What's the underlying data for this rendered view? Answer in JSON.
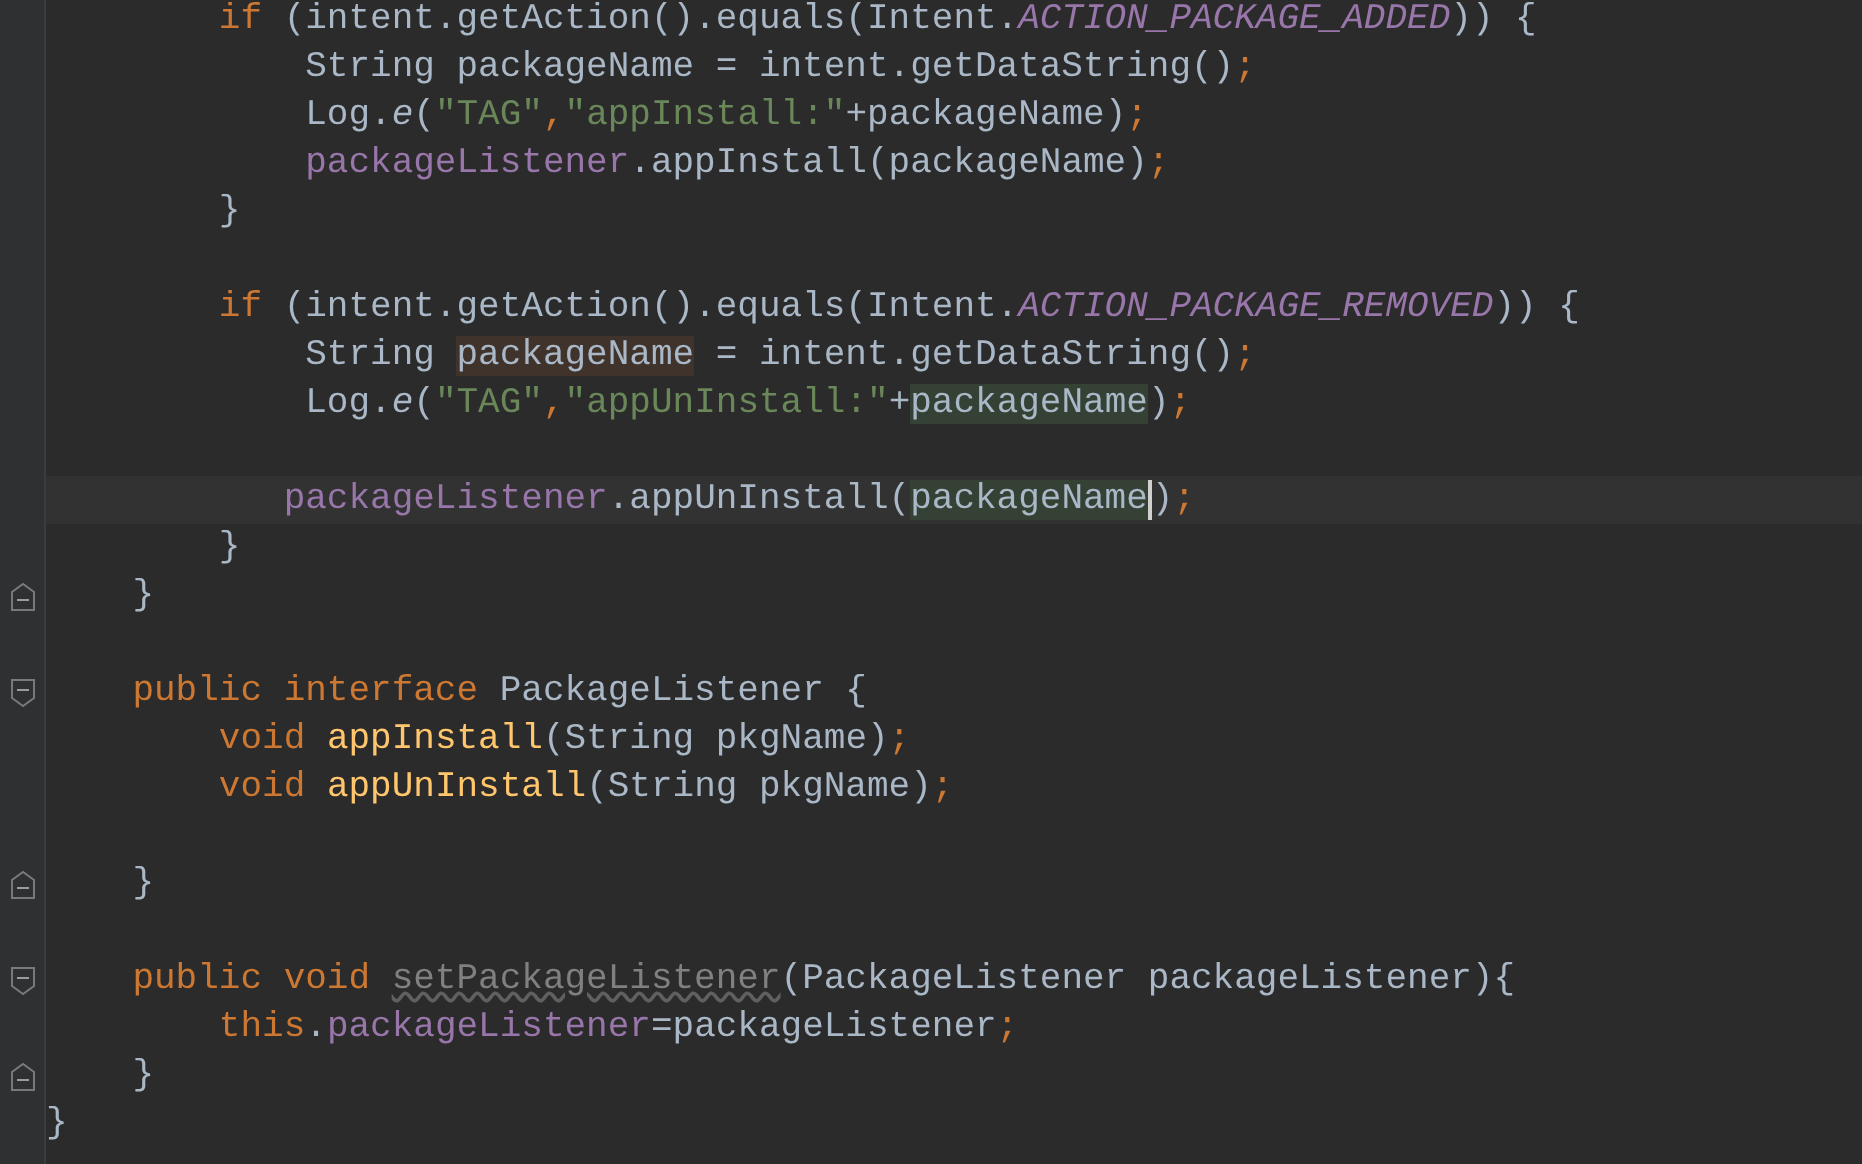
{
  "editor": {
    "lines": [
      {
        "kind": "code",
        "tokens": [
          {
            "text": "        if",
            "kind": "keyword"
          },
          {
            "text": " (intent.getAction().equals(Intent.",
            "kind": "plain"
          },
          {
            "text": "ACTION_PACKAGE_ADDED",
            "kind": "constant"
          },
          {
            "text": ")) {",
            "kind": "plain"
          }
        ]
      },
      {
        "kind": "code",
        "tokens": [
          {
            "text": "            String packageName = intent.getDataString()",
            "kind": "plain"
          },
          {
            "text": ";",
            "kind": "keyword"
          }
        ]
      },
      {
        "kind": "code",
        "tokens": [
          {
            "text": "            Log.",
            "kind": "plain"
          },
          {
            "text": "e",
            "kind": "static"
          },
          {
            "text": "(",
            "kind": "plain"
          },
          {
            "text": "\"TAG\"",
            "kind": "string"
          },
          {
            "text": ",",
            "kind": "keyword"
          },
          {
            "text": "\"appInstall:\"",
            "kind": "string"
          },
          {
            "text": "+packageName)",
            "kind": "plain"
          },
          {
            "text": ";",
            "kind": "keyword"
          }
        ]
      },
      {
        "kind": "code",
        "tokens": [
          {
            "text": "            packageListener",
            "kind": "field"
          },
          {
            "text": ".appInstall(packageName)",
            "kind": "plain"
          },
          {
            "text": ";",
            "kind": "keyword"
          }
        ]
      },
      {
        "kind": "code",
        "tokens": [
          {
            "text": "        }",
            "kind": "plain"
          }
        ]
      },
      {
        "kind": "blank"
      },
      {
        "kind": "code",
        "tokens": [
          {
            "text": "        if",
            "kind": "keyword"
          },
          {
            "text": " (intent.getAction().equals(Intent.",
            "kind": "plain"
          },
          {
            "text": "ACTION_PACKAGE_REMOVED",
            "kind": "constant"
          },
          {
            "text": ")) {",
            "kind": "plain"
          }
        ]
      },
      {
        "kind": "code",
        "tokens": [
          {
            "text": "            String ",
            "kind": "plain"
          },
          {
            "text": "packageName",
            "kind": "write-usage"
          },
          {
            "text": " = intent.getDataString()",
            "kind": "plain"
          },
          {
            "text": ";",
            "kind": "keyword"
          }
        ]
      },
      {
        "kind": "code",
        "tokens": [
          {
            "text": "            Log.",
            "kind": "plain"
          },
          {
            "text": "e",
            "kind": "static"
          },
          {
            "text": "(",
            "kind": "plain"
          },
          {
            "text": "\"TAG\"",
            "kind": "string"
          },
          {
            "text": ",",
            "kind": "keyword"
          },
          {
            "text": "\"appUnInstall:\"",
            "kind": "string"
          },
          {
            "text": "+",
            "kind": "plain"
          },
          {
            "text": "packageName",
            "kind": "read-usage"
          },
          {
            "text": ")",
            "kind": "plain"
          },
          {
            "text": ";",
            "kind": "keyword"
          }
        ]
      },
      {
        "kind": "blank"
      },
      {
        "kind": "code",
        "current": true,
        "tokens": [
          {
            "text": "           packageListener",
            "kind": "field"
          },
          {
            "text": ".appUnInstall(",
            "kind": "plain"
          },
          {
            "text": "packageName",
            "kind": "read-usage",
            "caret": true
          },
          {
            "text": ")",
            "kind": "plain"
          },
          {
            "text": ";",
            "kind": "keyword"
          }
        ]
      },
      {
        "kind": "code",
        "tokens": [
          {
            "text": "        }",
            "kind": "plain"
          }
        ]
      },
      {
        "kind": "fold-end",
        "tokens": [
          {
            "text": "    }",
            "kind": "plain"
          }
        ]
      },
      {
        "kind": "blank"
      },
      {
        "kind": "fold-start",
        "tokens": [
          {
            "text": "    public interface ",
            "kind": "keyword"
          },
          {
            "text": "PackageListener {",
            "kind": "plain"
          }
        ]
      },
      {
        "kind": "code",
        "tokens": [
          {
            "text": "        void ",
            "kind": "keyword"
          },
          {
            "text": "appInstall",
            "kind": "declaration"
          },
          {
            "text": "(String pkgName)",
            "kind": "plain"
          },
          {
            "text": ";",
            "kind": "keyword"
          }
        ]
      },
      {
        "kind": "code",
        "tokens": [
          {
            "text": "        void ",
            "kind": "keyword"
          },
          {
            "text": "appUnInstall",
            "kind": "declaration"
          },
          {
            "text": "(String pkgName)",
            "kind": "plain"
          },
          {
            "text": ";",
            "kind": "keyword"
          }
        ]
      },
      {
        "kind": "blank"
      },
      {
        "kind": "fold-end",
        "tokens": [
          {
            "text": "    }",
            "kind": "plain"
          }
        ]
      },
      {
        "kind": "blank"
      },
      {
        "kind": "fold-start",
        "tokens": [
          {
            "text": "    public void ",
            "kind": "keyword"
          },
          {
            "text": "setPackageListener",
            "kind": "unused"
          },
          {
            "text": "(PackageListener packageListener){",
            "kind": "plain"
          }
        ]
      },
      {
        "kind": "code",
        "tokens": [
          {
            "text": "        this",
            "kind": "keyword"
          },
          {
            "text": ".",
            "kind": "plain"
          },
          {
            "text": "packageListener",
            "kind": "field"
          },
          {
            "text": "=packageListener",
            "kind": "plain"
          },
          {
            "text": ";",
            "kind": "keyword"
          }
        ]
      },
      {
        "kind": "fold-end",
        "tokens": [
          {
            "text": "    }",
            "kind": "plain"
          }
        ]
      },
      {
        "kind": "code",
        "tokens": [
          {
            "text": "}",
            "kind": "plain"
          }
        ]
      }
    ]
  }
}
